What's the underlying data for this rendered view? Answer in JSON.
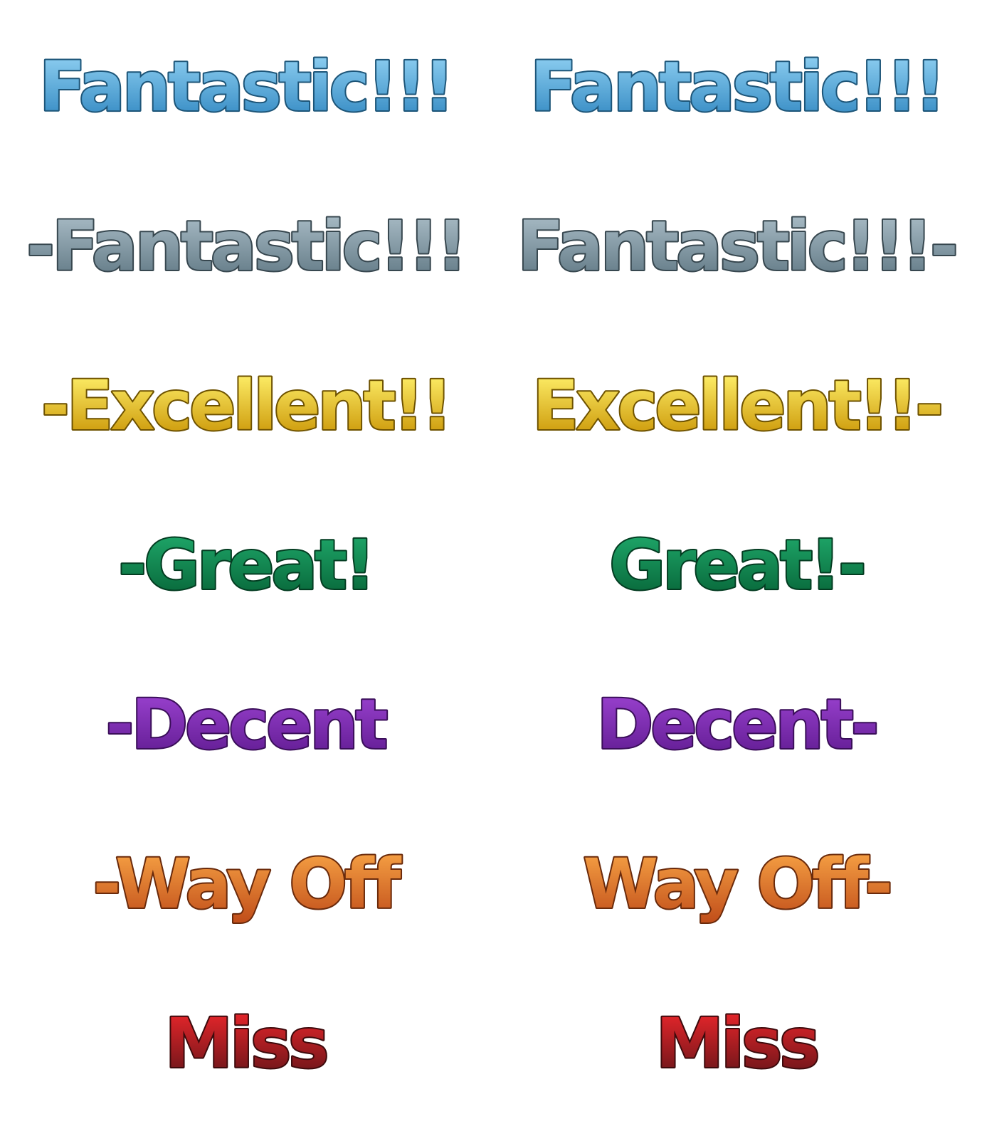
{
  "judgments": [
    {
      "id": "fantastic-blue",
      "left_text": "Fantastic!!!",
      "right_text": "Fantastic!!!",
      "colors": {
        "top": "#8fd0f2",
        "bottom": "#2f86c0",
        "outline": "#1d5578"
      }
    },
    {
      "id": "fantastic-white",
      "left_text": "-Fantastic!!!",
      "right_text": "Fantastic!!!-",
      "colors": {
        "top": "#a9bcc6",
        "bottom": "#5e7682",
        "outline": "#37474f"
      }
    },
    {
      "id": "excellent",
      "left_text": "-Excellent!!",
      "right_text": "Excellent!!-",
      "colors": {
        "top": "#fff06a",
        "bottom": "#c79000",
        "outline": "#6e5200"
      }
    },
    {
      "id": "great",
      "left_text": "-Great!",
      "right_text": "Great!-",
      "colors": {
        "top": "#1fa86a",
        "bottom": "#066236",
        "outline": "#033c21"
      }
    },
    {
      "id": "decent",
      "left_text": "-Decent",
      "right_text": "Decent-",
      "colors": {
        "top": "#9b42d0",
        "bottom": "#5e1a8f",
        "outline": "#3a0e59"
      }
    },
    {
      "id": "way-off",
      "left_text": "-Way Off",
      "right_text": "Way Off-",
      "colors": {
        "top": "#f6a144",
        "bottom": "#c2501b",
        "outline": "#6a2a0b"
      }
    },
    {
      "id": "miss",
      "left_text": "Miss",
      "right_text": "Miss",
      "colors": {
        "top": "#e9262b",
        "bottom": "#641418",
        "outline": "#3d0a0c"
      }
    }
  ]
}
